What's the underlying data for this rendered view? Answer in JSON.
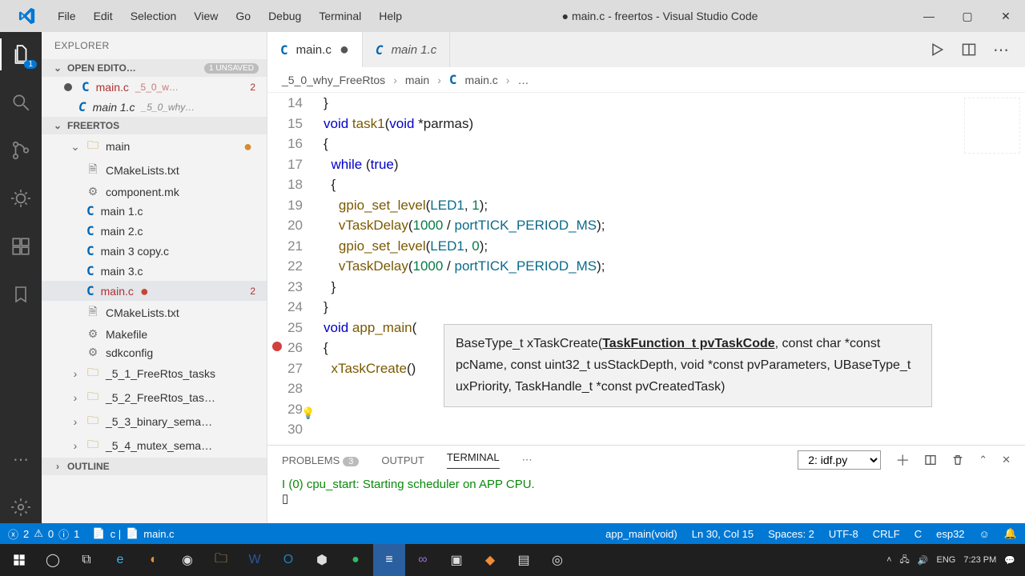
{
  "window": {
    "title": "● main.c - freertos - Visual Studio Code",
    "menu": [
      "File",
      "Edit",
      "Selection",
      "View",
      "Go",
      "Debug",
      "Terminal",
      "Help"
    ]
  },
  "activity": {
    "badge_files": "1"
  },
  "explorer": {
    "title": "EXPLORER",
    "open_editors": {
      "label": "OPEN EDITO…",
      "pill": "1 UNSAVED"
    },
    "open_items": [
      {
        "name": "main.c",
        "meta": "_5_0_w…",
        "errors": "2",
        "modified": true
      },
      {
        "name": "main 1.c",
        "meta": "_5_0_why…",
        "italic": true
      }
    ],
    "project": "FREERTOS",
    "tree": {
      "folder": "main",
      "files": [
        {
          "icon": "txt",
          "name": "CMakeLists.txt"
        },
        {
          "icon": "mk",
          "name": "component.mk"
        },
        {
          "icon": "C",
          "name": "main 1.c"
        },
        {
          "icon": "C",
          "name": "main 2.c"
        },
        {
          "icon": "C",
          "name": "main 3 copy.c"
        },
        {
          "icon": "C",
          "name": "main 3.c"
        },
        {
          "icon": "C",
          "name": "main.c",
          "errors": "2",
          "selected": true,
          "reddot": true
        },
        {
          "icon": "txt",
          "name": "CMakeLists.txt"
        },
        {
          "icon": "mk",
          "name": "Makefile"
        },
        {
          "icon": "cfg",
          "name": "sdkconfig"
        }
      ],
      "siblings": [
        "_5_1_FreeRtos_tasks",
        "_5_2_FreeRtos_tas…",
        "_5_3_binary_sema…",
        "_5_4_mutex_sema…"
      ],
      "outline": "OUTLINE"
    }
  },
  "tabs": [
    {
      "label": "main.c",
      "active": true,
      "modified": true
    },
    {
      "label": "main 1.c",
      "italic": true
    }
  ],
  "crumbs": [
    "_5_0_why_FreeRtos",
    "main",
    "main.c",
    "…"
  ],
  "code": {
    "first_line": 14,
    "lines": [
      "}",
      "",
      "void task1(void *parmas)",
      "{",
      "  while (true)",
      "  {",
      "",
      "    gpio_set_level(LED1, 1);",
      "    vTaskDelay(1000 / portTICK_PERIOD_MS);",
      "    gpio_set_level(LED1, 0);",
      "    vTaskDelay(1000 / portTICK_PERIOD_MS);",
      "  }",
      "}",
      "",
      "void app_main(",
      "{",
      "  xTaskCreate()"
    ],
    "breakpoint_line": 26,
    "bulb_line": 29,
    "hint": {
      "prefix": "BaseType_t xTaskCreate(",
      "active": "TaskFunction_t pvTaskCode",
      "rest": ", const char *const pcName, const uint32_t usStackDepth, void *const pvParameters, UBaseType_t uxPriority, TaskHandle_t *const pvCreatedTask)"
    }
  },
  "panel": {
    "tabs": {
      "problems": "PROBLEMS",
      "problems_cnt": "3",
      "output": "OUTPUT",
      "terminal": "TERMINAL"
    },
    "dropdown": "2: idf.py",
    "log": "I (0) cpu_start: Starting scheduler on APP CPU.",
    "prompt": "▯"
  },
  "status": {
    "errors": "2",
    "warnings": "0",
    "info": "1",
    "scope": "c | ",
    "file": "main.c",
    "fn": "app_main(void)",
    "ln": "Ln 30, Col 15",
    "spaces": "Spaces: 2",
    "enc": "UTF-8",
    "eol": "CRLF",
    "lang": "C",
    "target": "esp32"
  },
  "taskbar": {
    "lang": "ENG",
    "time": "7:23 PM",
    "date": ""
  }
}
